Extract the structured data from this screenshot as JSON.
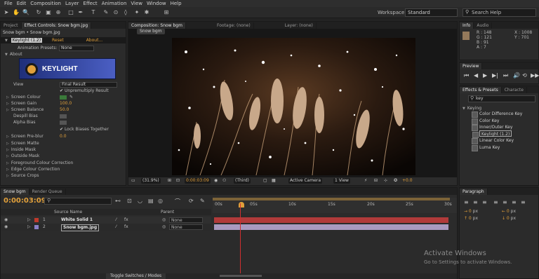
{
  "menu": [
    "File",
    "Edit",
    "Composition",
    "Layer",
    "Effect",
    "Animation",
    "View",
    "Window",
    "Help"
  ],
  "workspace": {
    "label": "Workspace:",
    "value": "Standard"
  },
  "search_help": {
    "placeholder": "Search Help"
  },
  "project_panel": {
    "tabs": {
      "project": "Project",
      "effect_controls": "Effect Controls: Snow bgm.jpg"
    },
    "breadcrumb": "Snow bgm • Snow bgm.jpg",
    "effect": {
      "name": "Keylight (1.2)",
      "reset": "Reset",
      "about": "About..."
    },
    "presets": {
      "label": "Animation Presets:",
      "value": "None"
    },
    "about": "About",
    "logo": "KEYLIGHT",
    "view": {
      "label": "View",
      "value": "Final Result"
    },
    "unpremultiply": "Unpremultiply Result",
    "properties": [
      {
        "label": "Screen Colour",
        "value": ""
      },
      {
        "label": "Screen Gain",
        "value": "100.0"
      },
      {
        "label": "Screen Balance",
        "value": "50.0"
      },
      {
        "label": "Despill Bias",
        "value": ""
      },
      {
        "label": "Alpha Bias",
        "value": ""
      }
    ],
    "lock_biases": "Lock Biases Together",
    "pre_blur": {
      "label": "Screen Pre-blur",
      "value": "0.0"
    },
    "sections": [
      "Screen Matte",
      "Inside Mask",
      "Outside Mask",
      "Foreground Colour Correction",
      "Edge Colour Correction",
      "Source Crops"
    ]
  },
  "comp_panel": {
    "tabs": {
      "composition": "Composition: Snow bgm",
      "footage": "Footage: (none)",
      "layer": "Layer: (none)"
    },
    "crumb": "Snow bgm",
    "controls": {
      "zoom": "(31.9%)",
      "timecode": "0:00:03:09",
      "resolution": "(Third)",
      "camera": "Active Camera",
      "views": "1 View",
      "exposure": "+0.0"
    }
  },
  "info_panel": {
    "tabs": {
      "info": "Info",
      "audio": "Audio"
    },
    "r": "R : 148",
    "g": "G : 121",
    "b": "B : 91",
    "a": "A : 7",
    "x": "X : 1008",
    "y": "Y : 701",
    "swatch_color": "#94795b"
  },
  "preview_panel": {
    "tab": "Preview"
  },
  "effects_panel": {
    "tabs": {
      "effects": "Effects & Presets",
      "characters": "Characte"
    },
    "search": "key",
    "group": "Keying",
    "items": [
      "Color Difference Key",
      "Color Key",
      "Inner/Outer Key",
      "Keylight (1.2)",
      "Linear Color Key",
      "Luma Key"
    ]
  },
  "paragraph_panel": {
    "tab": "Paragraph",
    "fields": [
      {
        "a": "px",
        "b": "px"
      },
      {
        "a": "px",
        "b": "px"
      }
    ]
  },
  "timeline": {
    "tabs": {
      "comp": "Snow bgm",
      "render_queue": "Render Queue"
    },
    "timecode": "0:00:03:09",
    "columns": {
      "source_name": "Source Name",
      "parent": "Parent"
    },
    "ruler": [
      "00s",
      "05s",
      "10s",
      "15s",
      "20s",
      "25s",
      "30s"
    ],
    "layers": [
      {
        "num": "1",
        "name": "White Solid 1",
        "parent": "None",
        "label_color": "#c0392b",
        "bar_color": "#b13a3a"
      },
      {
        "num": "2",
        "name": "Snow bgm.jpg",
        "parent": "None",
        "label_color": "#8a7fc7",
        "bar_color": "#a99ac0"
      }
    ],
    "toggle": "Toggle Switches / Modes"
  },
  "watermark": {
    "title": "Activate Windows",
    "subtitle": "Go to Settings to activate Windows."
  }
}
